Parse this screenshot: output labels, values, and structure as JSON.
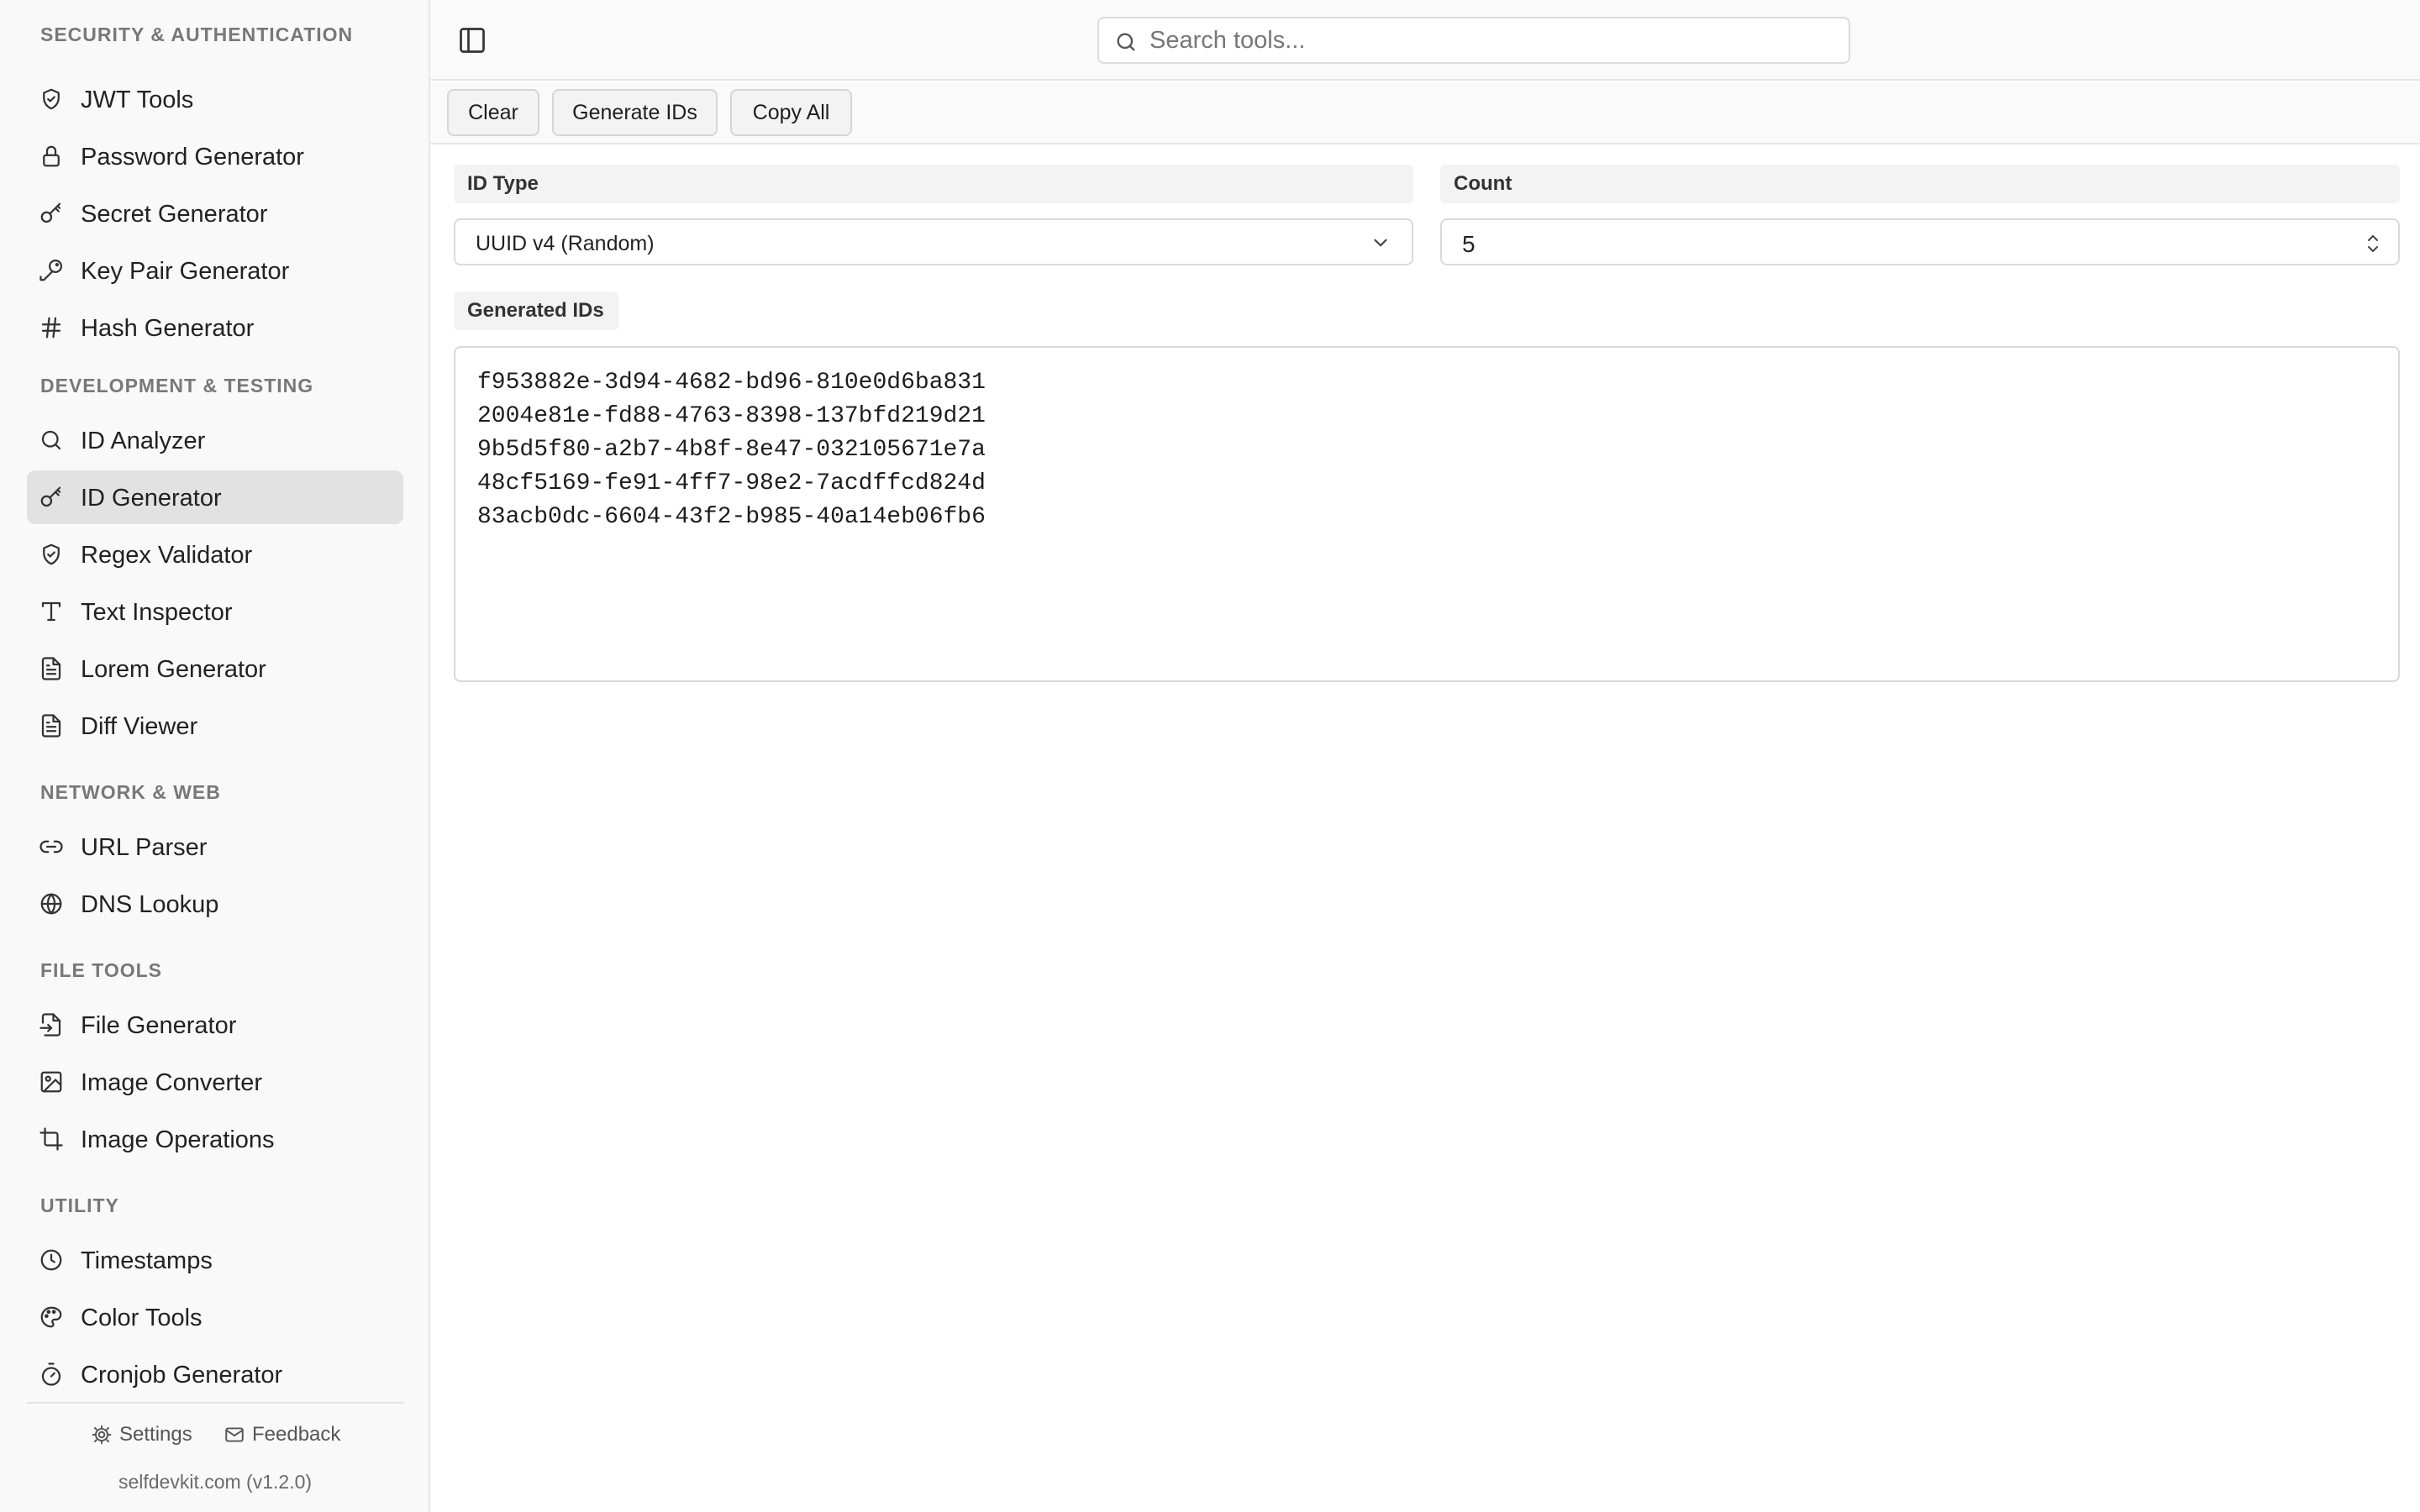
{
  "sidebar": {
    "truncated_header": "SECURITY & AUTHENTICATION",
    "sections": [
      {
        "header": "",
        "items": [
          {
            "label": "JWT Tools",
            "icon": "shield-check-icon"
          },
          {
            "label": "Password Generator",
            "icon": "lock-icon"
          },
          {
            "label": "Secret Generator",
            "icon": "key-icon"
          },
          {
            "label": "Key Pair Generator",
            "icon": "key-round-icon"
          },
          {
            "label": "Hash Generator",
            "icon": "hash-icon"
          }
        ]
      },
      {
        "header": "DEVELOPMENT & TESTING",
        "items": [
          {
            "label": "ID Analyzer",
            "icon": "search-icon"
          },
          {
            "label": "ID Generator",
            "icon": "key-icon",
            "active": true
          },
          {
            "label": "Regex Validator",
            "icon": "shield-check-icon"
          },
          {
            "label": "Text Inspector",
            "icon": "type-icon"
          },
          {
            "label": "Lorem Generator",
            "icon": "file-text-icon"
          },
          {
            "label": "Diff Viewer",
            "icon": "file-text-icon"
          }
        ]
      },
      {
        "header": "NETWORK & WEB",
        "items": [
          {
            "label": "URL Parser",
            "icon": "link-icon"
          },
          {
            "label": "DNS Lookup",
            "icon": "globe-icon"
          }
        ]
      },
      {
        "header": "FILE TOOLS",
        "items": [
          {
            "label": "File Generator",
            "icon": "file-input-icon"
          },
          {
            "label": "Image Converter",
            "icon": "image-icon"
          },
          {
            "label": "Image Operations",
            "icon": "crop-icon"
          }
        ]
      },
      {
        "header": "UTILITY",
        "items": [
          {
            "label": "Timestamps",
            "icon": "clock-icon"
          },
          {
            "label": "Color Tools",
            "icon": "palette-icon"
          },
          {
            "label": "Cronjob Generator",
            "icon": "timer-icon"
          }
        ]
      }
    ],
    "footer": {
      "settings_label": "Settings",
      "feedback_label": "Feedback",
      "version": "selfdevkit.com (v1.2.0)"
    }
  },
  "header": {
    "toggle_icon": "panel-left-icon",
    "search_placeholder": "Search tools..."
  },
  "toolbar": {
    "clear_label": "Clear",
    "generate_label": "Generate IDs",
    "copy_label": "Copy All"
  },
  "main": {
    "id_type_label": "ID Type",
    "id_type_value": "UUID v4 (Random)",
    "count_label": "Count",
    "count_value": "5",
    "output_label": "Generated IDs",
    "generated_ids": [
      "f953882e-3d94-4682-bd96-810e0d6ba831",
      "2004e81e-fd88-4763-8398-137bfd219d21",
      "9b5d5f80-a2b7-4b8f-8e47-032105671e7a",
      "48cf5169-fe91-4ff7-98e2-7acdffcd824d",
      "83acb0dc-6604-43f2-b985-40a14eb06fb6"
    ]
  },
  "colors": {
    "sidebar_bg": "#f9f9f9",
    "active_item_bg": "#e2e2e2",
    "border": "#e6e6e6",
    "section_header": "#787878"
  }
}
